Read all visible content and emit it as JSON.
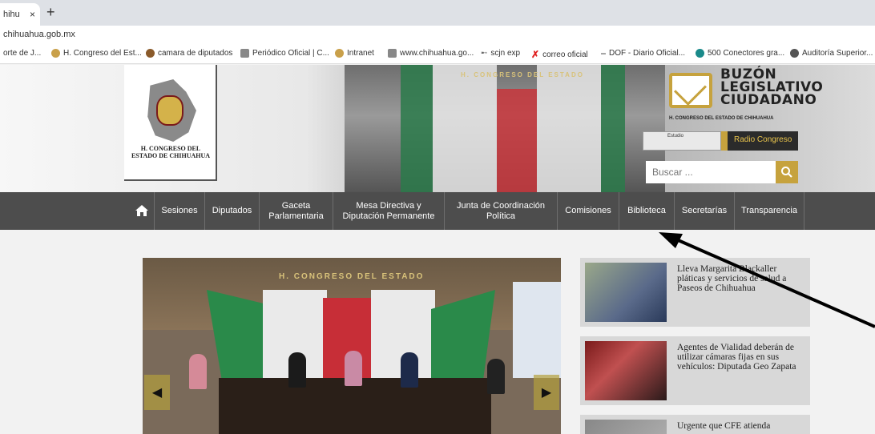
{
  "browser": {
    "tab_title": "hihu",
    "tab_close": "×",
    "new_tab": "+",
    "url": "chihuahua.gob.mx",
    "bookmarks": [
      {
        "label": "orte de J...",
        "icon": "none"
      },
      {
        "label": "H. Congreso del Est...",
        "icon": "congress-icon"
      },
      {
        "label": "camara de diputados",
        "icon": "camara-icon"
      },
      {
        "label": "Periódico Oficial | C...",
        "icon": "shield-icon"
      },
      {
        "label": "Intranet",
        "icon": "congress-icon"
      },
      {
        "label": "www.chihuahua.go...",
        "icon": "shield-icon"
      },
      {
        "label": "scjn exp",
        "icon": "bird-icon"
      },
      {
        "label": "correo oficial",
        "icon": "x-mark-icon"
      },
      {
        "label": "DOF - Diario Oficial...",
        "icon": "dof-icon"
      },
      {
        "label": "500 Conectores gra...",
        "icon": "globe-icon"
      },
      {
        "label": "Auditoría Superior...",
        "icon": "globe-icon"
      }
    ]
  },
  "header": {
    "logo_text": "H. CONGRESO DEL ESTADO DE CHIHUAHUA",
    "banner_caption": "H. CONGRESO DEL ESTADO",
    "buzon_title_lines": [
      "BUZÓN",
      "LEGISLATIVO",
      "CIUDADANO"
    ],
    "buzon_subtitle": "H. CONGRESO DEL ESTADO DE CHIHUAHUA",
    "radio_left": "Estudio",
    "radio_label": "Radio Congreso",
    "search_placeholder": "Buscar ..."
  },
  "nav": {
    "items": [
      "Sesiones",
      "Diputados",
      "Gaceta Parlamentaria",
      "Mesa Directiva y Diputación Permanente",
      "Junta de Coordinación Política",
      "Comisiones",
      "Biblioteca",
      "Secretarías",
      "Transparencia"
    ]
  },
  "carousel": {
    "caption": "H. CONGRESO DEL ESTADO",
    "prev": "◀",
    "next": "▶"
  },
  "news": [
    {
      "title": "Lleva Margarita Blackaller pláticas y servicios de salud a Paseos de Chihuahua"
    },
    {
      "title": "Agentes de Vialidad deberán de utilizar cámaras fijas en sus vehículos: Diputada Geo Zapata"
    },
    {
      "title": "Urgente que CFE atienda"
    }
  ],
  "colors": {
    "nav_bg": "#4d4d4d",
    "accent_gold": "#c6a23d",
    "news_bg": "#d8d8d8"
  }
}
